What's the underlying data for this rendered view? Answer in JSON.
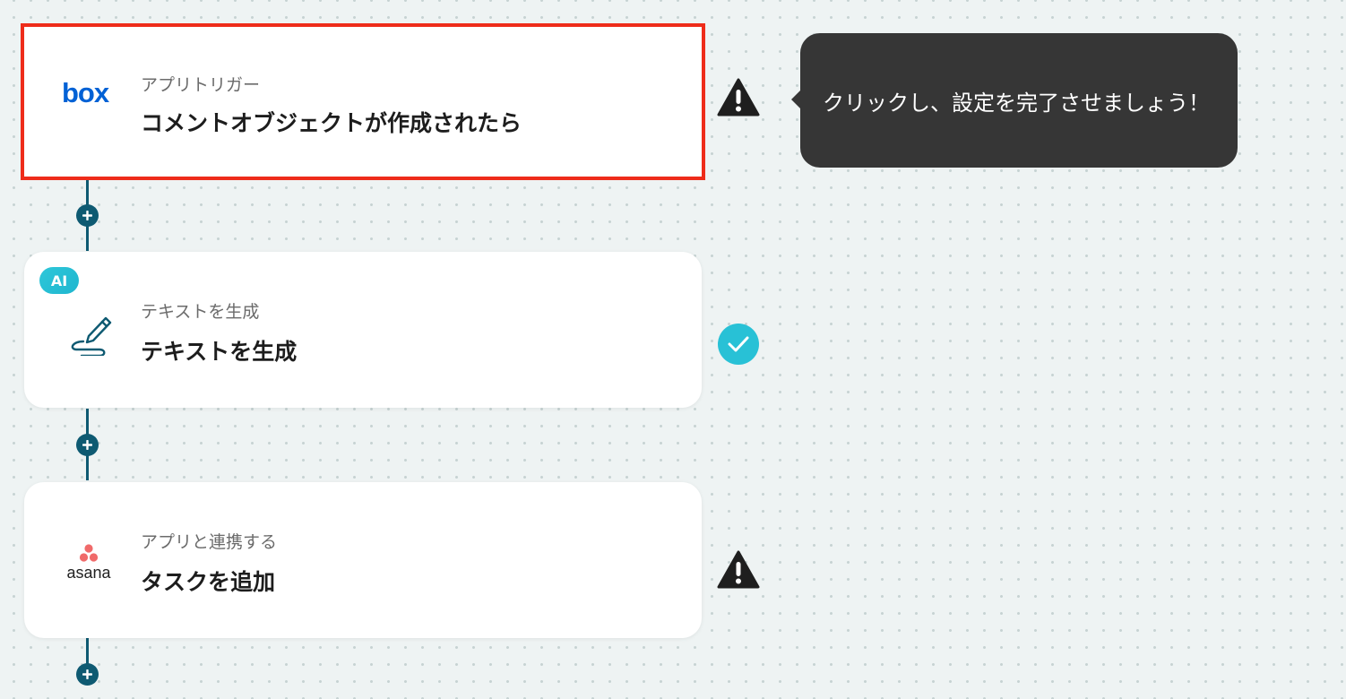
{
  "flow": {
    "steps": [
      {
        "app": "box",
        "app_logo_text": "box",
        "subtitle": "アプリトリガー",
        "title": "コメントオブジェクトが作成されたら",
        "status": "warning",
        "selected": true
      },
      {
        "app": "ai",
        "badge": "AI",
        "subtitle": "テキストを生成",
        "title": "テキストを生成",
        "status": "complete",
        "selected": false
      },
      {
        "app": "asana",
        "app_logo_text": "asana",
        "subtitle": "アプリと連携する",
        "title": "タスクを追加",
        "status": "warning",
        "selected": false
      }
    ]
  },
  "tooltip": {
    "text": "クリックし、設定を完了させましょう！"
  },
  "icons": {
    "step1": "box-logo-icon",
    "step2": "pen-squiggle-icon",
    "step3": "asana-logo-icon",
    "warning": "warning-triangle-icon",
    "complete": "check-circle-icon",
    "add": "plus-icon"
  },
  "colors": {
    "connector": "#0e5a72",
    "selected_border": "#ee2c1a",
    "ai_badge": "#2ec7d9",
    "check": "#28c1d6",
    "box_brand": "#0061d5",
    "asana_brand": "#f06a6a",
    "tooltip_bg": "#363636"
  }
}
